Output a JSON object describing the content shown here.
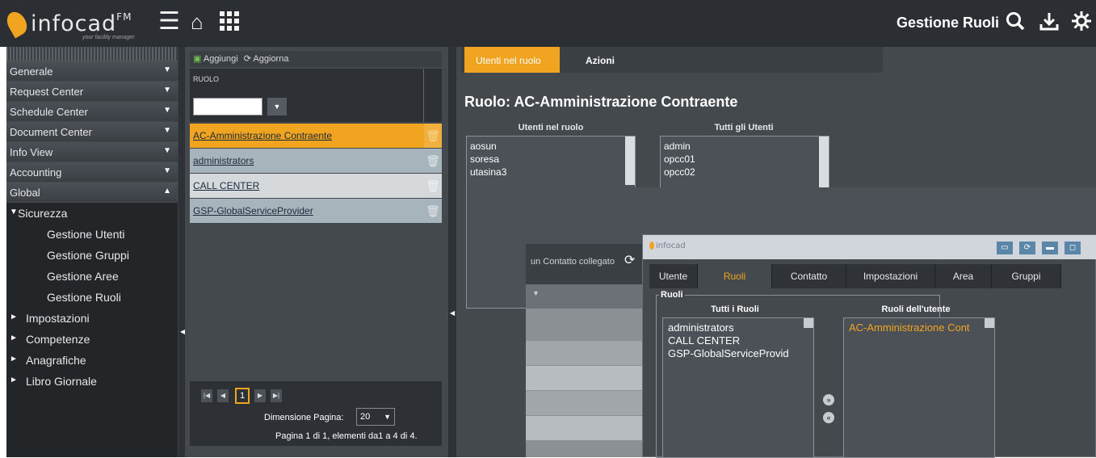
{
  "app": {
    "brand": "infocad",
    "brand_sup": "FM",
    "tagline": "your facility manager",
    "page_title": "Gestione Ruoli"
  },
  "icons": {
    "menu": "hamburger-icon",
    "home": "home-icon",
    "apps": "grid-icon",
    "search": "search-icon",
    "download": "download-icon",
    "settings": "gear-icon"
  },
  "sidebar": {
    "sections": [
      {
        "label": "Generale",
        "arrow": "▼"
      },
      {
        "label": "Request Center",
        "arrow": "▼"
      },
      {
        "label": "Schedule Center",
        "arrow": "▼"
      },
      {
        "label": "Document Center",
        "arrow": "▼"
      },
      {
        "label": "Info View",
        "arrow": "▼"
      },
      {
        "label": "Accounting",
        "arrow": "▼"
      },
      {
        "label": "Global",
        "arrow": "▲"
      }
    ],
    "tree": [
      {
        "label": "Sicurezza",
        "tri": "▼"
      },
      {
        "label": "Gestione Utenti"
      },
      {
        "label": "Gestione Gruppi"
      },
      {
        "label": "Gestione Aree"
      },
      {
        "label": "Gestione Ruoli"
      },
      {
        "label": "Impostazioni",
        "tri": "►"
      },
      {
        "label": "Competenze",
        "tri": "►"
      },
      {
        "label": "Anagrafiche",
        "tri": "►"
      },
      {
        "label": "Libro Giornale",
        "tri": "►"
      }
    ]
  },
  "roles": {
    "add_label": "Aggiungi",
    "refresh_label": "Aggiorna",
    "column_header": "RUOLO",
    "rows": [
      {
        "label": "AC-Amministrazione Contraente"
      },
      {
        "label": "administrators"
      },
      {
        "label": "CALL CENTER"
      },
      {
        "label": "GSP-GlobalServiceProvider"
      }
    ],
    "pager": {
      "current_page": "1",
      "page_size_label": "Dimensione Pagina:",
      "page_size": "20",
      "info": "Pagina 1 di 1, elementi da1 a 4 di 4."
    }
  },
  "detail": {
    "tabs": [
      {
        "label": "Utenti nel ruolo",
        "active": true
      },
      {
        "label": "Azioni",
        "active": false
      }
    ],
    "role_title": "Ruolo: AC-Amministrazione Contraente",
    "users_in_role_label": "Utenti nel ruolo",
    "users_in_role": [
      "aosun",
      "soresa",
      "utasina3"
    ],
    "all_users_label": "Tutti gli Utenti",
    "all_users": [
      "admin",
      "opcc01",
      "opcc02"
    ]
  },
  "overlay": {
    "row_text": "un Contatto collegato"
  },
  "user_dialog": {
    "logo": "infocad",
    "window_buttons": [
      "▭",
      "⟳",
      "▬",
      "◻"
    ],
    "tabs": [
      {
        "label": "Utente",
        "active": false
      },
      {
        "label": "Ruoli",
        "active": true
      },
      {
        "label": "Contatto",
        "active": false
      },
      {
        "label": "Impostazioni",
        "active": false
      },
      {
        "label": "Area",
        "active": false
      },
      {
        "label": "Gruppi",
        "active": false
      }
    ],
    "section_label": "Ruoli",
    "all_roles_label": "Tutti i Ruoli",
    "all_roles": [
      "administrators",
      "CALL CENTER",
      "GSP-GlobalServiceProvid"
    ],
    "user_roles_label": "Ruoli dell'utente",
    "user_roles": [
      "AC-Amministrazione Cont"
    ]
  },
  "colors": {
    "accent": "#f0a420",
    "topbar": "#2b2f33",
    "panel": "#44494e",
    "selected_row": "#f0a420",
    "row": "#a8b4bc",
    "row_alt": "#d5d9dc"
  }
}
